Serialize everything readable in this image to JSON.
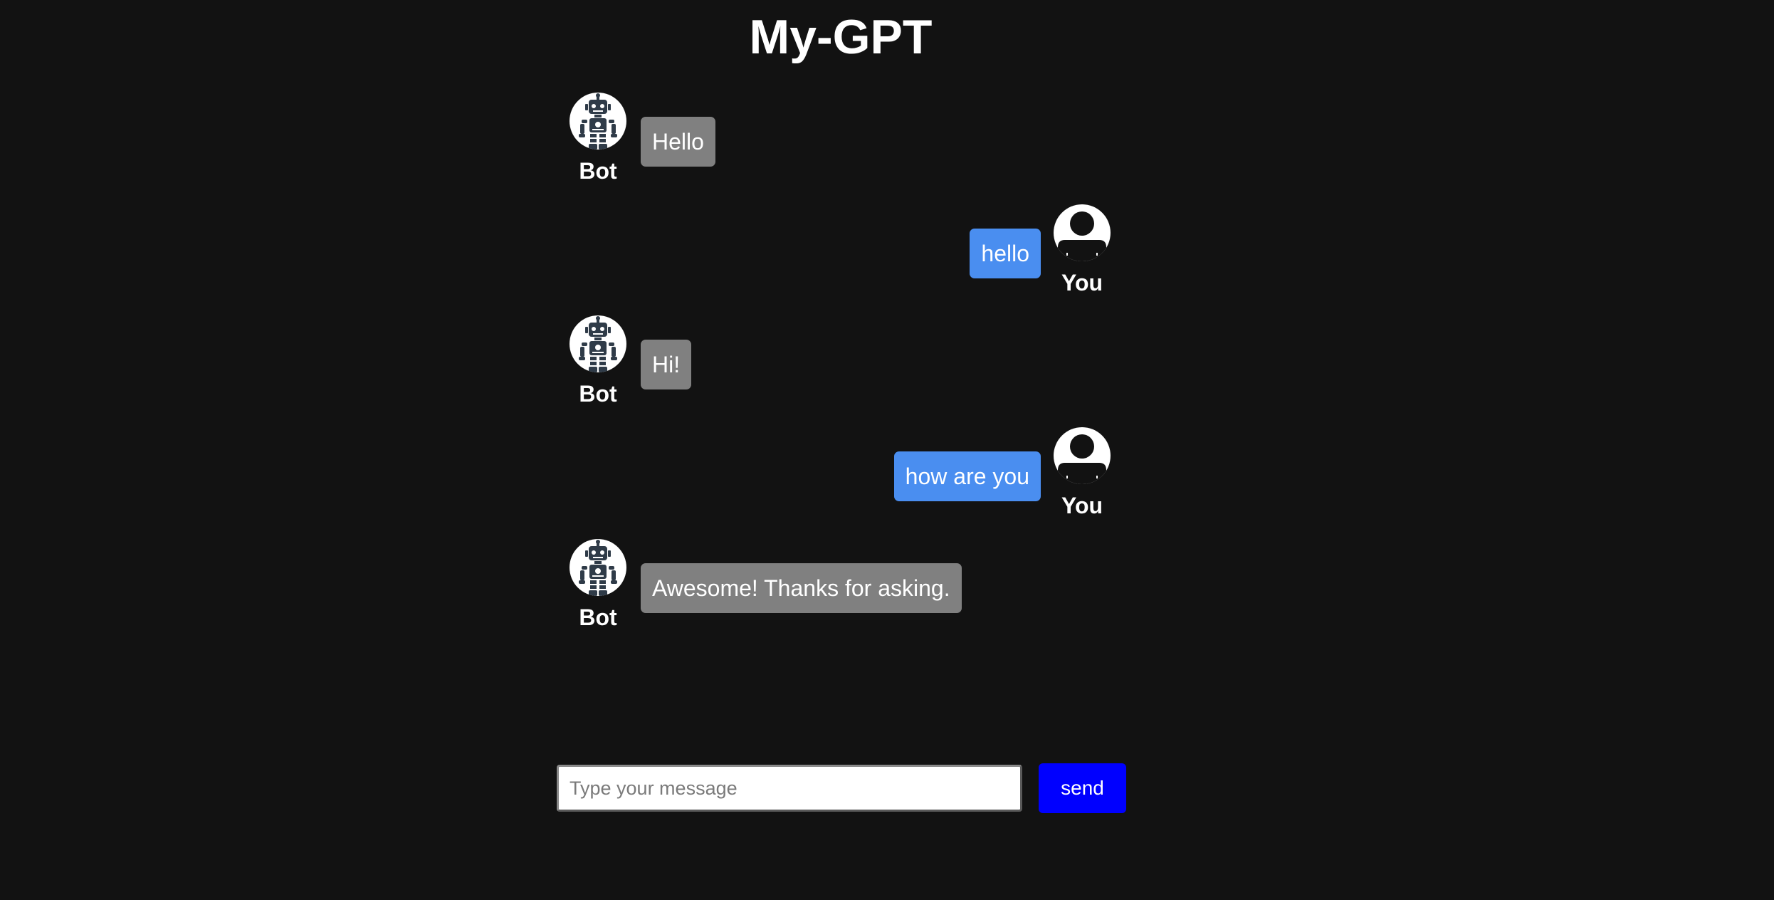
{
  "app": {
    "title": "My-GPT"
  },
  "messages": [
    {
      "sender": "bot",
      "name": "Bot",
      "text": "Hello",
      "avatar_icon": "robot-icon"
    },
    {
      "sender": "user",
      "name": "You",
      "text": "hello",
      "avatar_icon": "user-avatar-icon"
    },
    {
      "sender": "bot",
      "name": "Bot",
      "text": "Hi!",
      "avatar_icon": "robot-icon"
    },
    {
      "sender": "user",
      "name": "You",
      "text": "how are you",
      "avatar_icon": "user-avatar-icon"
    },
    {
      "sender": "bot",
      "name": "Bot",
      "text": "Awesome! Thanks for asking.",
      "avatar_icon": "robot-icon"
    }
  ],
  "composer": {
    "placeholder": "Type your message",
    "value": "",
    "send_label": "send"
  },
  "colors": {
    "background": "#121212",
    "bot_bubble": "#808080",
    "user_bubble": "#4a8ef0",
    "send_button": "#0000ff"
  }
}
